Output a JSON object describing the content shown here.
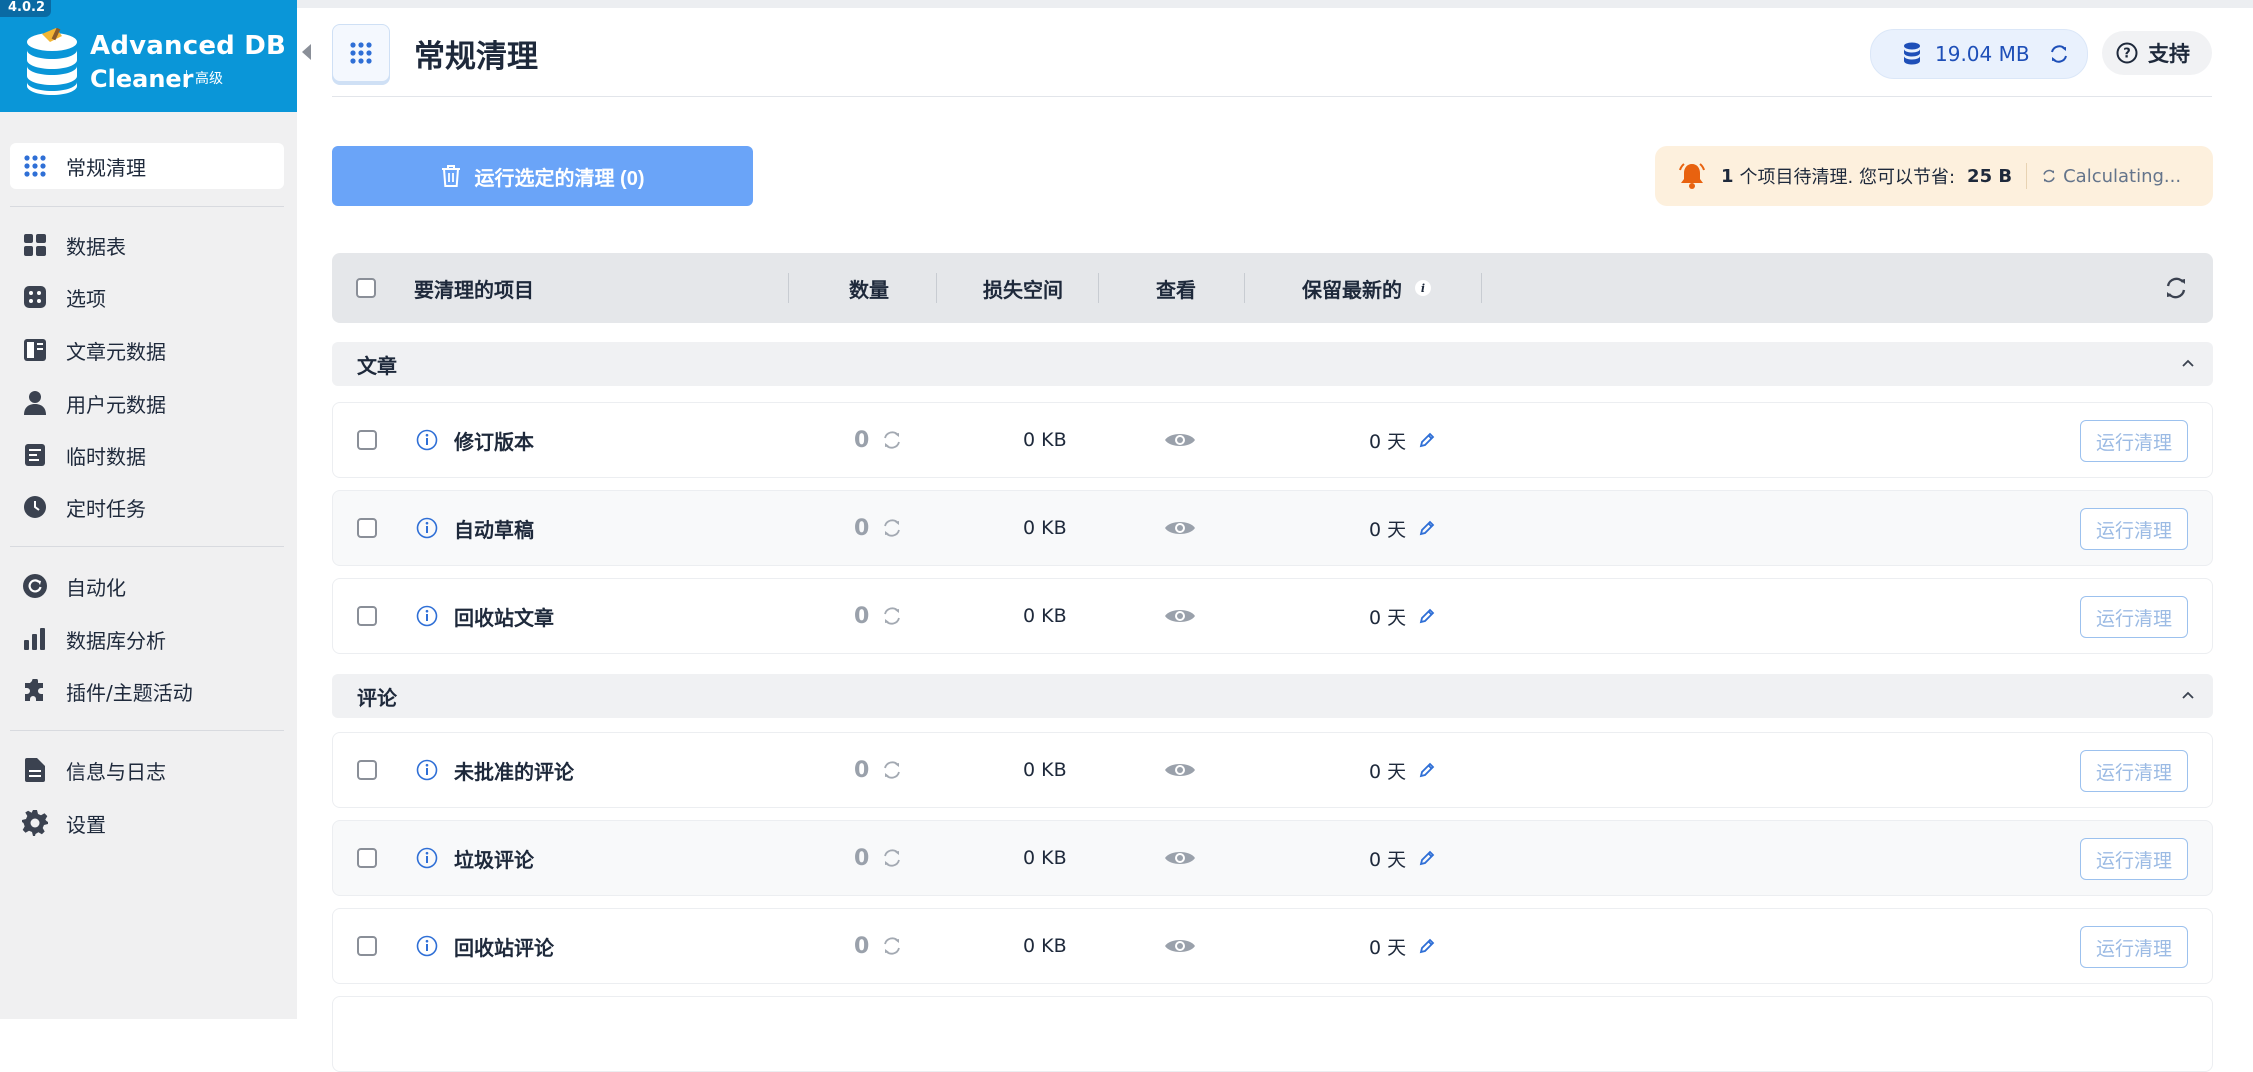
{
  "app": {
    "version": "4.0.2",
    "name_line1": "Advanced DB",
    "name_line2": "Cleaner",
    "edition": "高级"
  },
  "sidebar": {
    "items": [
      {
        "label": "常规清理",
        "icon": "grid-dots-icon",
        "active": true
      },
      {
        "label": "数据表",
        "icon": "tables-icon"
      },
      {
        "label": "选项",
        "icon": "dice-icon"
      },
      {
        "label": "文章元数据",
        "icon": "post-meta-icon"
      },
      {
        "label": "用户元数据",
        "icon": "user-icon"
      },
      {
        "label": "临时数据",
        "icon": "transient-icon"
      },
      {
        "label": "定时任务",
        "icon": "clock-icon"
      },
      {
        "label": "自动化",
        "icon": "automation-icon"
      },
      {
        "label": "数据库分析",
        "icon": "bar-chart-icon"
      },
      {
        "label": "插件/主题活动",
        "icon": "puzzle-icon"
      },
      {
        "label": "信息与日志",
        "icon": "document-icon"
      },
      {
        "label": "设置",
        "icon": "gear-icon"
      }
    ]
  },
  "header": {
    "title": "常规清理",
    "db_size": "19.04 MB",
    "support_label": "支持"
  },
  "actions": {
    "run_selected_label": "运行选定的清理 (0)",
    "notice_count": "1",
    "notice_text": "个项目待清理. 您可以节省:",
    "notice_savings": "25 B",
    "calculating": "Calculating..."
  },
  "table": {
    "columns": {
      "item": "要清理的项目",
      "count": "数量",
      "lost_space": "损失空间",
      "view": "查看",
      "keep_last": "保留最新的"
    },
    "sections": [
      {
        "title": "文章",
        "rows": [
          {
            "name": "修订版本",
            "count": "0",
            "size": "0 KB",
            "keep": "0 天",
            "action": "运行清理"
          },
          {
            "name": "自动草稿",
            "count": "0",
            "size": "0 KB",
            "keep": "0 天",
            "action": "运行清理"
          },
          {
            "name": "回收站文章",
            "count": "0",
            "size": "0 KB",
            "keep": "0 天",
            "action": "运行清理"
          }
        ]
      },
      {
        "title": "评论",
        "rows": [
          {
            "name": "未批准的评论",
            "count": "0",
            "size": "0 KB",
            "keep": "0 天",
            "action": "运行清理"
          },
          {
            "name": "垃圾评论",
            "count": "0",
            "size": "0 KB",
            "keep": "0 天",
            "action": "运行清理"
          },
          {
            "name": "回收站评论",
            "count": "0",
            "size": "0 KB",
            "keep": "0 天",
            "action": "运行清理"
          }
        ]
      }
    ]
  },
  "colors": {
    "brand": "#0a96d8",
    "accent": "#2f6fd6",
    "primary_button": "#6aa4f8",
    "notice_bg": "#fdf0dd",
    "bell": "#e8620f"
  }
}
